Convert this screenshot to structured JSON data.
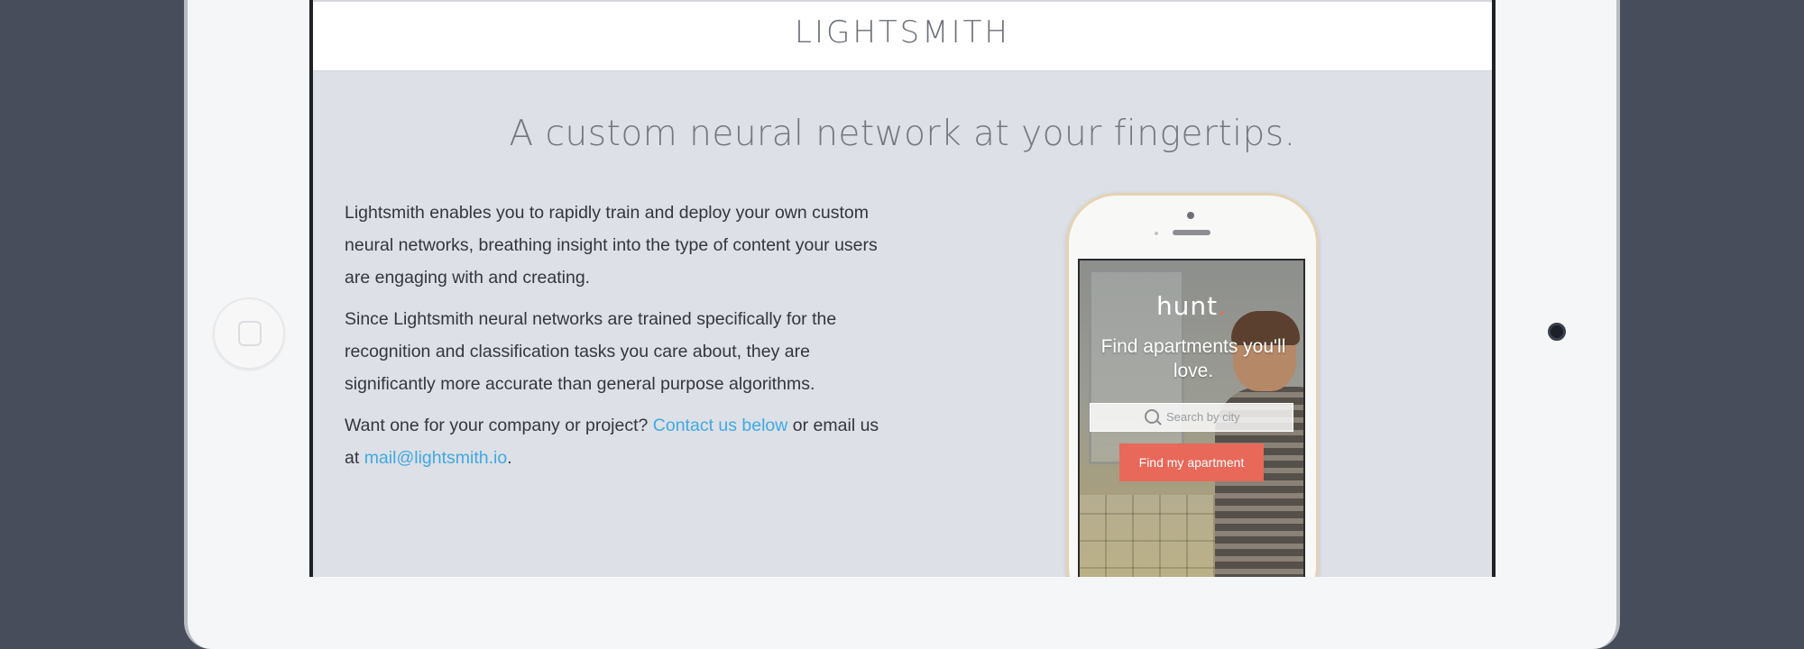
{
  "site": {
    "logo": "LIGHTSMITH",
    "headline": "A custom neural network at your fingertips.",
    "paragraphs": {
      "p1": "Lightsmith enables you to rapidly train and deploy your own custom neural networks, breathing insight into the type of content your users are engaging with and creating.",
      "p2": "Since Lightsmith neural networks are trained specifically for the recognition and classification tasks you care about, they are significantly more accurate than general purpose algorithms.",
      "p3_before": "Want one for your company or project? ",
      "p3_link": "Contact us below",
      "p3_middle": " or email us at ",
      "p3_email": "mail@lightsmith.io",
      "p3_end": "."
    }
  },
  "phone_app": {
    "logo": "hunt",
    "logo_dot": ".",
    "tagline": "Find apartments you'll love.",
    "search_placeholder": "Search by city",
    "button_label": "Find my apartment"
  },
  "colors": {
    "link": "#3fa9e3",
    "page_background": "#dde0e6",
    "app_button": "#e8685a"
  },
  "icons": [
    "search-icon"
  ]
}
